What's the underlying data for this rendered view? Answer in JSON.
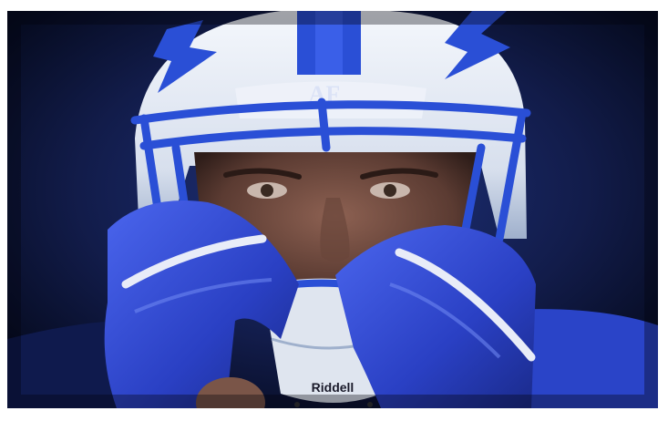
{
  "photo": {
    "helmet_logo_text": "AF",
    "facemask_brand_text": "Riddell",
    "colors": {
      "background_dark": "#0a1230",
      "background_mid": "#1b2c73",
      "helmet_white": "#e9eef6",
      "helmet_shadow": "#9fb0cc",
      "accent_blue": "#2a4fd6",
      "glove_blue": "#2f49d8",
      "glove_highlight": "#6d85f0",
      "skin": "#7a5548",
      "skin_dark": "#4a2f28"
    }
  }
}
